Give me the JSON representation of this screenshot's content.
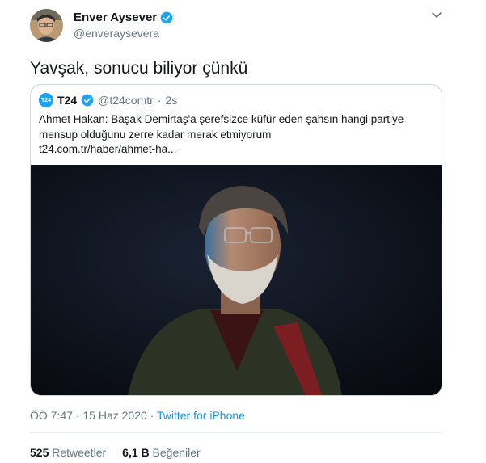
{
  "author": {
    "name": "Enver Aysever",
    "handle": "@enveraysevera"
  },
  "tweet": {
    "text": "Yavşak, sonucu biliyor çünkü"
  },
  "quoted": {
    "logo_text": "T24",
    "name": "T24",
    "handle": "@t24comtr",
    "separator": "·",
    "time": "2s",
    "text": "Ahmet Hakan: Başak Demirtaş'a şerefsizce küfür eden şahsın hangi partiye mensup olduğunu zerre kadar merak etmiyorum",
    "link": "t24.com.tr/haber/ahmet-ha..."
  },
  "meta": {
    "time": "ÖÖ 7:47",
    "separator1": "·",
    "date": "15 Haz 2020",
    "separator2": "·",
    "source": "Twitter for iPhone"
  },
  "stats": {
    "retweets_count": "525",
    "retweets_label": "Retweetler",
    "likes_count": "6,1 B",
    "likes_label": "Beğeniler"
  },
  "colors": {
    "accent": "#1da1f2",
    "secondary_text": "#657786",
    "border": "#ccd6dd"
  },
  "icons": [
    "verified-badge-icon",
    "chevron-down-icon"
  ]
}
